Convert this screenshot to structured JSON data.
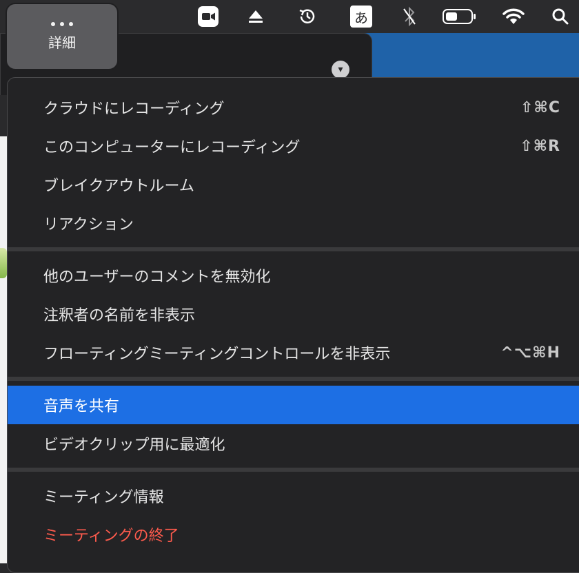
{
  "more_button": {
    "label": "詳細"
  },
  "menubar": {
    "icons": [
      "zoom-video-icon",
      "eject-icon",
      "time-machine-icon",
      "input-method-icon",
      "bluetooth-off-icon",
      "battery-icon",
      "wifi-icon",
      "search-icon"
    ],
    "input_method_label": "あ"
  },
  "menu": {
    "groups": [
      [
        {
          "label": "クラウドにレコーディング",
          "shortcut": "⇧⌘C"
        },
        {
          "label": "このコンピューターにレコーディング",
          "shortcut": "⇧⌘R"
        },
        {
          "label": "ブレイクアウトルーム",
          "shortcut": ""
        },
        {
          "label": "リアクション",
          "shortcut": ""
        }
      ],
      [
        {
          "label": "他のユーザーのコメントを無効化",
          "shortcut": ""
        },
        {
          "label": "注釈者の名前を非表示",
          "shortcut": ""
        },
        {
          "label": "フローティングミーティングコントロールを非表示",
          "shortcut": "^⌥⌘H"
        }
      ],
      [
        {
          "label": "音声を共有",
          "shortcut": "",
          "selected": true
        },
        {
          "label": "ビデオクリップ用に最適化",
          "shortcut": ""
        }
      ],
      [
        {
          "label": "ミーティング情報",
          "shortcut": ""
        },
        {
          "label": "ミーティングの終了",
          "shortcut": "",
          "danger": true
        }
      ]
    ]
  },
  "colors": {
    "menu_background": "#232325",
    "selected_highlight": "#1d6fe4",
    "danger_text": "#ff5b4d"
  }
}
